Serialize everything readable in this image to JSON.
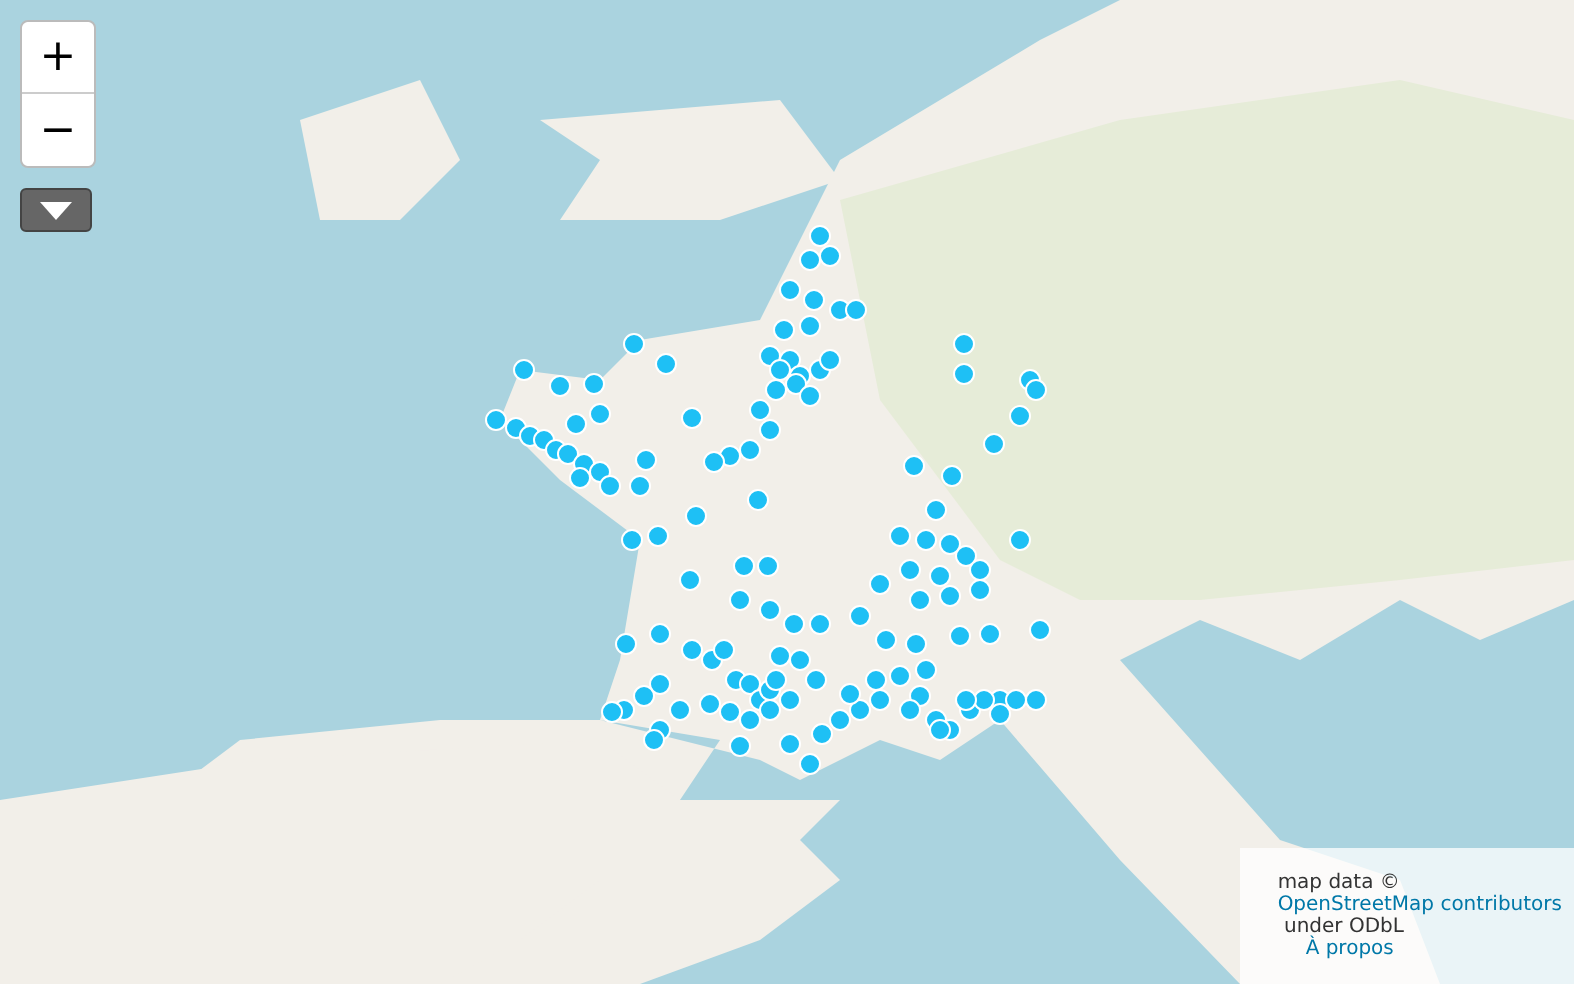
{
  "zoom_controls": {
    "zoom_in": "+",
    "zoom_out": "−"
  },
  "attribution": {
    "text": "map data © ",
    "link": "OpenStreetMap contributors",
    "license_text": " under ODbL",
    "about_link": "À propos"
  }
}
